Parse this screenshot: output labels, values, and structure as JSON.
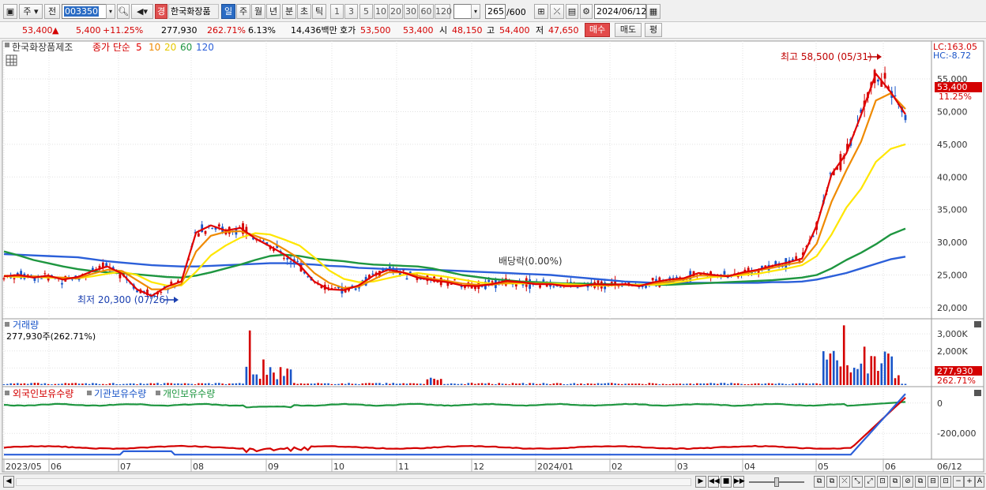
{
  "toolbar": {
    "type_select": "주",
    "prev_label": "전",
    "code": "003350",
    "market_badge": "경",
    "stock_name": "한국화장품",
    "periods": [
      "일",
      "주",
      "월",
      "년",
      "분",
      "초",
      "틱"
    ],
    "active_period": "일",
    "intervals": [
      "1",
      "3",
      "5",
      "10",
      "20",
      "30",
      "60",
      "120"
    ],
    "count": "265",
    "count_max": "/600",
    "date": "2024/06/12"
  },
  "quote": {
    "price": "53,400",
    "arrow": "▲",
    "change": "5,400",
    "change_pct": "+11.25%",
    "volume": "277,930",
    "volume_ratio": "262.71%",
    "turnover": "6.13%",
    "amount": "14,436백만",
    "bid_label": "호가",
    "bid": "53,500",
    "ask": "53,400",
    "open_label": "시",
    "open": "48,150",
    "high_label": "고",
    "high": "54,400",
    "low_label": "저",
    "low": "47,650",
    "buy_label": "매수",
    "sell_label": "매도",
    "eval_label": "평"
  },
  "price_panel": {
    "legend_name": "한국화장품제조",
    "legend_ma_label": "종가 단순",
    "legend_ma": [
      "5",
      "10",
      "20",
      "60",
      "120"
    ],
    "lc_label": "LC:163.05",
    "hc_label": "HC:-8.72",
    "high_note": "최고 58,500 (05/31)",
    "low_note": "최저 20,300 (07/26)",
    "dividend_note": "배당락(0.00%)",
    "price_tag": "53,400",
    "pct_tag": "11.25%"
  },
  "volume_panel": {
    "title": "거래량",
    "summary": "277,930주(262.71%)",
    "tag": "277,930",
    "tag_pct": "262.71%"
  },
  "holding_panel": {
    "legend": [
      "외국인보유수량",
      "기관보유수량",
      "개인보유수량"
    ]
  },
  "x_axis_labels": [
    "2023/05",
    "06",
    "07",
    "08",
    "09",
    "10",
    "11",
    "12",
    "2024/01",
    "02",
    "03",
    "04",
    "05",
    "06"
  ],
  "x_axis_right": "06/12",
  "colors": {
    "ma5": "#e00000",
    "ma10": "#ef8a00",
    "ma20": "#ffe600",
    "ma60": "#1e9640",
    "ma120": "#2b5fd9",
    "up": "#d40000",
    "down": "#1a55c8"
  },
  "chart_data": [
    {
      "type": "candlestick",
      "title": "한국화장품제조",
      "y_ticks": [
        20000,
        25000,
        30000,
        35000,
        40000,
        45000,
        50000,
        55000
      ],
      "y_tick_labels": [
        "20,000",
        "25,000",
        "30,000",
        "35,000",
        "40,000",
        "45,000",
        "50,000",
        "55,000"
      ],
      "ylim": [
        18300,
        60800
      ],
      "x_months": [
        "2023/05",
        "06",
        "07",
        "08",
        "09",
        "10",
        "11",
        "12",
        "2024/01",
        "02",
        "03",
        "04",
        "05",
        "06"
      ],
      "series": [
        {
          "name": "5",
          "values": [
            24800,
            25000,
            24600,
            24900,
            24300,
            24700,
            25600,
            26300,
            25200,
            22800,
            21800,
            23200,
            24000,
            31500,
            32600,
            31800,
            32200,
            30600,
            29400,
            28100,
            26500,
            24000,
            22800,
            22700,
            23400,
            24900,
            25800,
            25400,
            24600,
            24200,
            23900,
            23400,
            23300,
            23600,
            24100,
            23900,
            23600,
            23600,
            23300,
            23300,
            23600,
            23500,
            23600,
            23300,
            23900,
            24300,
            24500,
            25300,
            25000,
            24800,
            25400,
            25800,
            26400,
            26900,
            27500,
            32600,
            40400,
            43600,
            49500,
            55800,
            53000,
            49600
          ]
        },
        {
          "name": "10",
          "values": [
            24900,
            24800,
            24800,
            24700,
            24600,
            24500,
            25200,
            25800,
            25600,
            24200,
            22800,
            22800,
            23600,
            28600,
            31000,
            31600,
            31700,
            31000,
            30200,
            28900,
            27500,
            25300,
            23800,
            23000,
            23200,
            24300,
            25400,
            25400,
            24900,
            24400,
            24100,
            23700,
            23500,
            23500,
            23800,
            23900,
            23700,
            23600,
            23400,
            23400,
            23500,
            23500,
            23500,
            23400,
            23700,
            24000,
            24300,
            24900,
            24900,
            24900,
            25200,
            25700,
            26100,
            26600,
            27000,
            29800,
            36200,
            41000,
            45400,
            51700,
            52800,
            50400
          ]
        },
        {
          "name": "20",
          "values": [
            24800,
            24700,
            24700,
            24600,
            24500,
            24500,
            24800,
            25200,
            25500,
            25000,
            23900,
            23400,
            23400,
            25500,
            28000,
            29500,
            30700,
            31400,
            31200,
            30400,
            29500,
            27700,
            25700,
            24400,
            23900,
            24000,
            24500,
            25000,
            25300,
            25000,
            24700,
            24300,
            23900,
            23700,
            23700,
            23700,
            23700,
            23700,
            23600,
            23500,
            23400,
            23400,
            23500,
            23500,
            23500,
            23700,
            24000,
            24400,
            24700,
            24800,
            25000,
            25200,
            25600,
            26000,
            26500,
            27900,
            31200,
            35300,
            38200,
            42300,
            44300,
            45000
          ]
        },
        {
          "name": "60",
          "values": [
            28600,
            28000,
            27300,
            26800,
            26300,
            25900,
            25600,
            25400,
            25300,
            25100,
            24900,
            24700,
            24600,
            24900,
            25400,
            26000,
            26600,
            27300,
            27900,
            28100,
            27900,
            27500,
            27300,
            27100,
            26800,
            26600,
            26500,
            26400,
            26300,
            26000,
            25500,
            25000,
            24700,
            24400,
            24200,
            24000,
            23900,
            23800,
            23700,
            23700,
            23600,
            23600,
            23500,
            23500,
            23500,
            23500,
            23600,
            23700,
            23800,
            23900,
            24000,
            24100,
            24200,
            24400,
            24600,
            25000,
            26000,
            27300,
            28400,
            29700,
            31200,
            32100
          ]
        },
        {
          "name": "120",
          "values": [
            28200,
            28100,
            28000,
            27900,
            27800,
            27700,
            27400,
            27100,
            26900,
            26700,
            26500,
            26400,
            26300,
            26300,
            26400,
            26500,
            26600,
            26700,
            26800,
            26800,
            26700,
            26600,
            26400,
            26300,
            26100,
            26000,
            25900,
            25900,
            25800,
            25800,
            25700,
            25600,
            25500,
            25400,
            25300,
            25200,
            25100,
            25000,
            24800,
            24600,
            24400,
            24200,
            24000,
            23900,
            23800,
            23800,
            23800,
            23800,
            23800,
            23800,
            23800,
            23800,
            23900,
            23900,
            24000,
            24300,
            24800,
            25300,
            26000,
            26700,
            27400,
            27800
          ]
        }
      ]
    },
    {
      "type": "bar",
      "title": "거래량",
      "y_ticks": [
        1000,
        2000,
        3000
      ],
      "y_tick_labels": [
        "",
        "2,000K",
        "3,000K"
      ],
      "ylim": [
        0,
        3700
      ],
      "note": "volume in thousands of shares"
    },
    {
      "type": "line",
      "title": "외국인보유수량 / 기관보유수량 / 개인보유수량",
      "y_ticks": [
        0,
        -200000
      ],
      "y_tick_labels": [
        "0",
        "-200,000"
      ],
      "ylim": [
        -360000,
        30000
      ]
    }
  ]
}
